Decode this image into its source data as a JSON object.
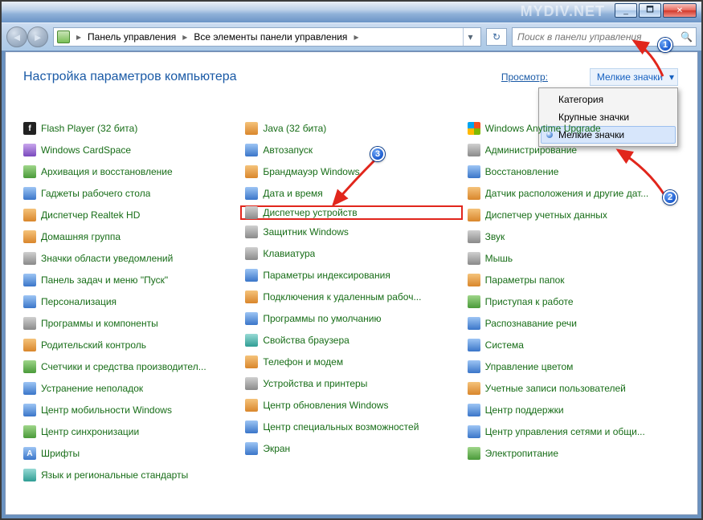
{
  "watermark": "MYDIV.NET",
  "winbtns": {
    "min": "_",
    "max": "🗖",
    "close": "✕"
  },
  "nav": {
    "back": "◄",
    "fwd": "►"
  },
  "breadcrumb": {
    "a": "Панель управления",
    "b": "Все элементы панели управления"
  },
  "refresh": "↻",
  "search_placeholder": "Поиск в панели управления",
  "search_icon": "🔍",
  "heading": "Настройка параметров компьютера",
  "view_label": "Просмотр:",
  "view_value": "Мелкие значки",
  "menu": {
    "cat": "Категория",
    "large": "Крупные значки",
    "small": "Мелкие значки"
  },
  "badges": {
    "one": "1",
    "two": "2",
    "three": "3"
  },
  "col1": {
    "i0": "Flash Player (32 бита)",
    "i1": "Windows CardSpace",
    "i2": "Архивация и восстановление",
    "i3": "Гаджеты рабочего стола",
    "i4": "Диспетчер Realtek HD",
    "i5": "Домашняя группа",
    "i6": "Значки области уведомлений",
    "i7": "Панель задач и меню \"Пуск\"",
    "i8": "Персонализация",
    "i9": "Программы и компоненты",
    "i10": "Родительский контроль",
    "i11": "Счетчики и средства производител...",
    "i12": "Устранение неполадок",
    "i13": "Центр мобильности Windows",
    "i14": "Центр синхронизации",
    "i15": "Шрифты",
    "i16": "Язык и региональные стандарты"
  },
  "col2": {
    "i0": "Java (32 бита)",
    "i1": "Автозапуск",
    "i2": "Брандмауэр Windows",
    "i3": "Дата и время",
    "i4": "Диспетчер устройств",
    "i5": "Защитник Windows",
    "i6": "Клавиатура",
    "i7": "Параметры индексирования",
    "i8": "Подключения к удаленным рабоч...",
    "i9": "Программы по умолчанию",
    "i10": "Свойства браузера",
    "i11": "Телефон и модем",
    "i12": "Устройства и принтеры",
    "i13": "Центр обновления Windows",
    "i14": "Центр специальных возможностей",
    "i15": "Экран"
  },
  "col3": {
    "i0": "Windows Anytime Upgrade",
    "i1": "Администрирование",
    "i2": "Восстановление",
    "i3": "Датчик расположения и другие дат...",
    "i4": "Диспетчер учетных данных",
    "i5": "Звук",
    "i6": "Мышь",
    "i7": "Параметры папок",
    "i8": "Приступая к работе",
    "i9": "Распознавание речи",
    "i10": "Система",
    "i11": "Управление цветом",
    "i12": "Учетные записи пользователей",
    "i13": "Центр поддержки",
    "i14": "Центр управления сетями и общи...",
    "i15": "Электропитание"
  }
}
